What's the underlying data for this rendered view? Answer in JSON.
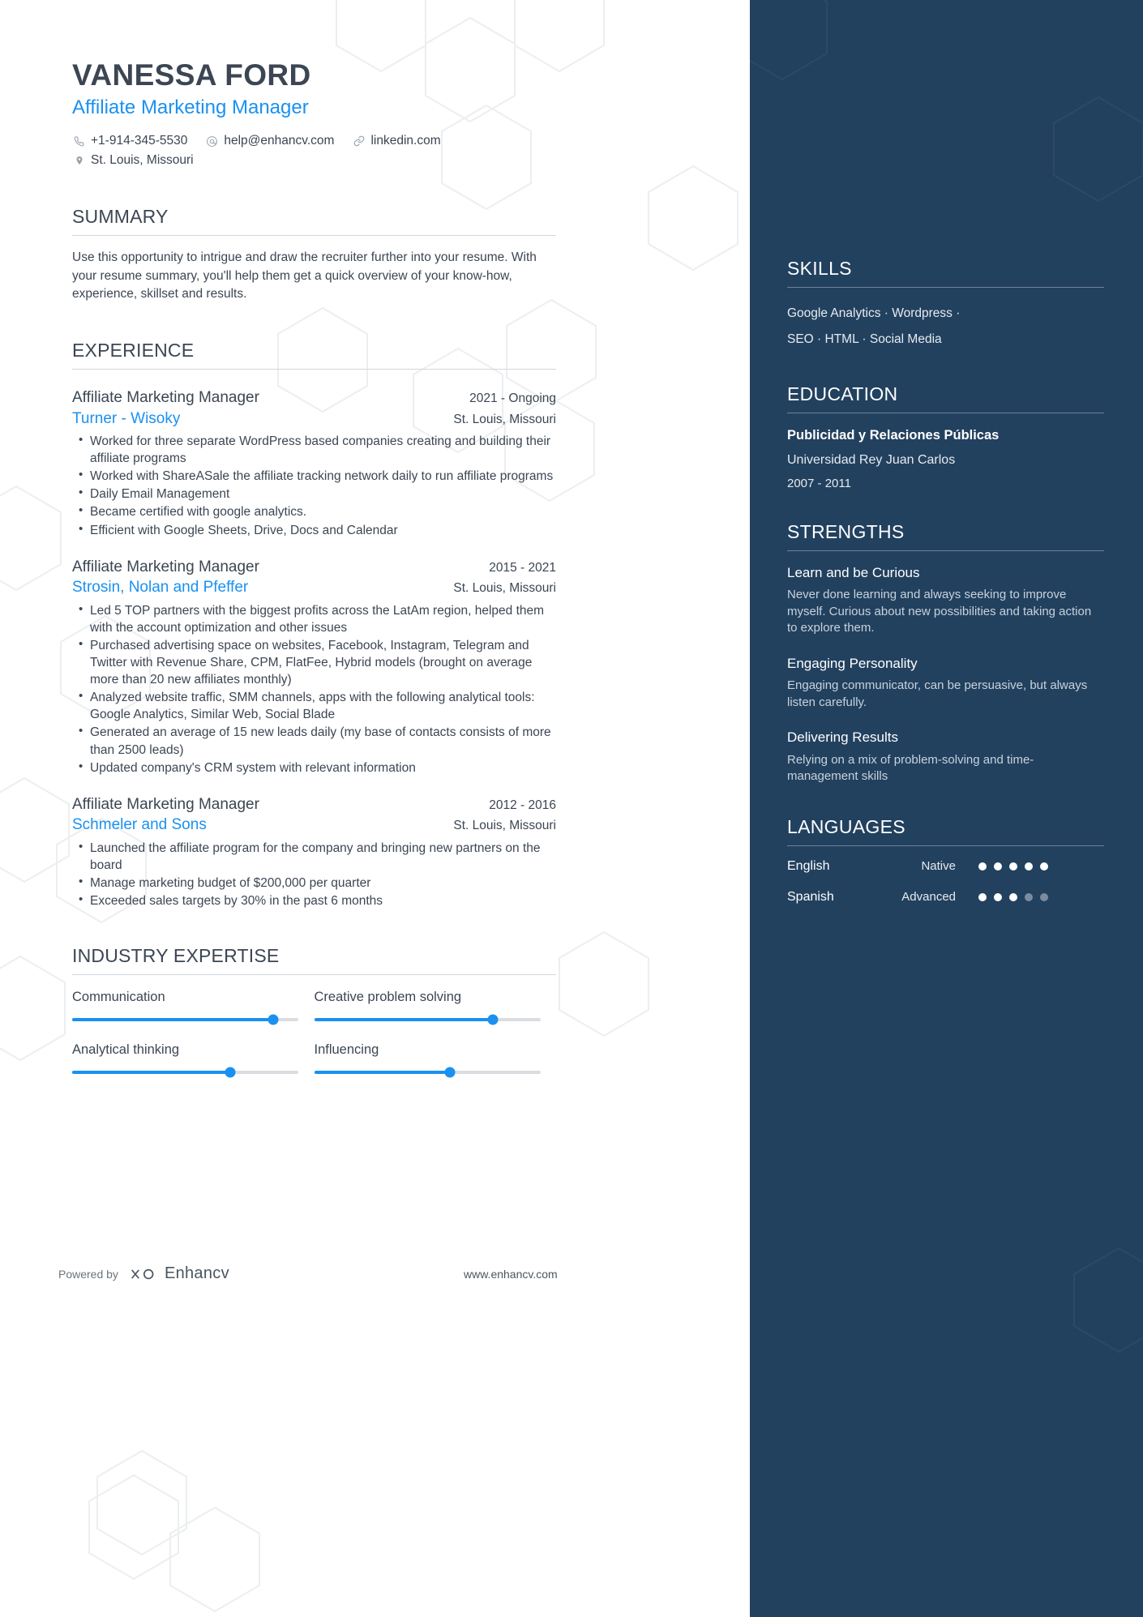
{
  "colors": {
    "accent": "#1a91f0",
    "sidebar_bg": "#22415f",
    "text": "#3c4653",
    "rule": "#d3d7dc"
  },
  "header": {
    "name": "VANESSA FORD",
    "job_title": "Affiliate Marketing Manager",
    "contacts": [
      {
        "icon": "phone-icon",
        "text": "+1-914-345-5530"
      },
      {
        "icon": "email-icon",
        "text": "help@enhancv.com"
      },
      {
        "icon": "link-icon",
        "text": "linkedin.com"
      }
    ],
    "location": {
      "icon": "location-pin-icon",
      "text": "St. Louis, Missouri"
    }
  },
  "summary": {
    "heading": "SUMMARY",
    "text": "Use this opportunity to intrigue and draw the recruiter further into your resume. With your resume summary, you'll help them get a quick overview of your know-how, experience, skillset and results."
  },
  "experience": {
    "heading": "EXPERIENCE",
    "jobs": [
      {
        "position": "Affiliate Marketing Manager",
        "date": "2021 - Ongoing",
        "company": "Turner - Wisoky",
        "location": "St. Louis, Missouri",
        "bullets": [
          "Worked for three separate WordPress based companies creating and building their affiliate programs",
          "Worked with ShareASale the affiliate tracking network daily to run affiliate programs",
          "Daily Email Management",
          "Became certified with google analytics.",
          "Efficient with Google Sheets, Drive, Docs and Calendar"
        ]
      },
      {
        "position": "Affiliate Marketing Manager",
        "date": "2015 - 2021",
        "company": "Strosin, Nolan and Pfeffer",
        "location": "St. Louis, Missouri",
        "bullets": [
          "Led 5 TOP partners with the biggest profits across the LatAm region, helped them with the account optimization and other issues",
          "Purchased advertising space on websites, Facebook, Instagram, Telegram and Twitter with Revenue Share, CPM, FlatFee, Hybrid models (brought on average more than 20 new affiliates monthly)",
          "Analyzed website traffic, SMM channels, apps with the following analytical tools: Google Analytics, Similar Web, Social Blade",
          "Generated an average of 15 new leads daily (my base of contacts consists of more than 2500 leads)",
          "Updated company's CRM system with relevant information"
        ]
      },
      {
        "position": "Affiliate Marketing Manager",
        "date": "2012 - 2016",
        "company": "Schmeler and Sons",
        "location": "St. Louis, Missouri",
        "bullets": [
          "Launched the affiliate program for the company and bringing new partners on the board",
          "Manage marketing budget of $200,000 per quarter",
          "Exceeded sales targets by 30% in the past 6 months"
        ]
      }
    ]
  },
  "industry_expertise": {
    "heading": "INDUSTRY EXPERTISE",
    "items": [
      {
        "label": "Communication",
        "value": 89
      },
      {
        "label": "Creative problem solving",
        "value": 79
      },
      {
        "label": "Analytical thinking",
        "value": 70
      },
      {
        "label": "Influencing",
        "value": 60
      }
    ]
  },
  "sidebar": {
    "skills": {
      "heading": "SKILLS",
      "lines": [
        "Google Analytics · Wordpress ·",
        "SEO · HTML · Social Media"
      ]
    },
    "education": {
      "heading": "EDUCATION",
      "degree": "Publicidad y Relaciones Públicas",
      "school": "Universidad Rey Juan Carlos",
      "years": "2007 - 2011"
    },
    "strengths": {
      "heading": "STRENGTHS",
      "items": [
        {
          "title": "Learn and be Curious",
          "desc": "Never done learning and always seeking to improve myself. Curious about new possibilities and taking action to explore them."
        },
        {
          "title": "Engaging Personality",
          "desc": "Engaging communicator, can be persuasive, but always listen carefully."
        },
        {
          "title": "Delivering Results",
          "desc": "Relying on a mix of problem-solving and time-management skills"
        }
      ]
    },
    "languages": {
      "heading": "LANGUAGES",
      "items": [
        {
          "name": "English",
          "level": "Native",
          "filled": 5,
          "total": 5
        },
        {
          "name": "Spanish",
          "level": "Advanced",
          "filled": 3,
          "total": 5
        }
      ]
    }
  },
  "footer": {
    "powered_by": "Powered by",
    "brand": "Enhancv",
    "url": "www.enhancv.com"
  }
}
